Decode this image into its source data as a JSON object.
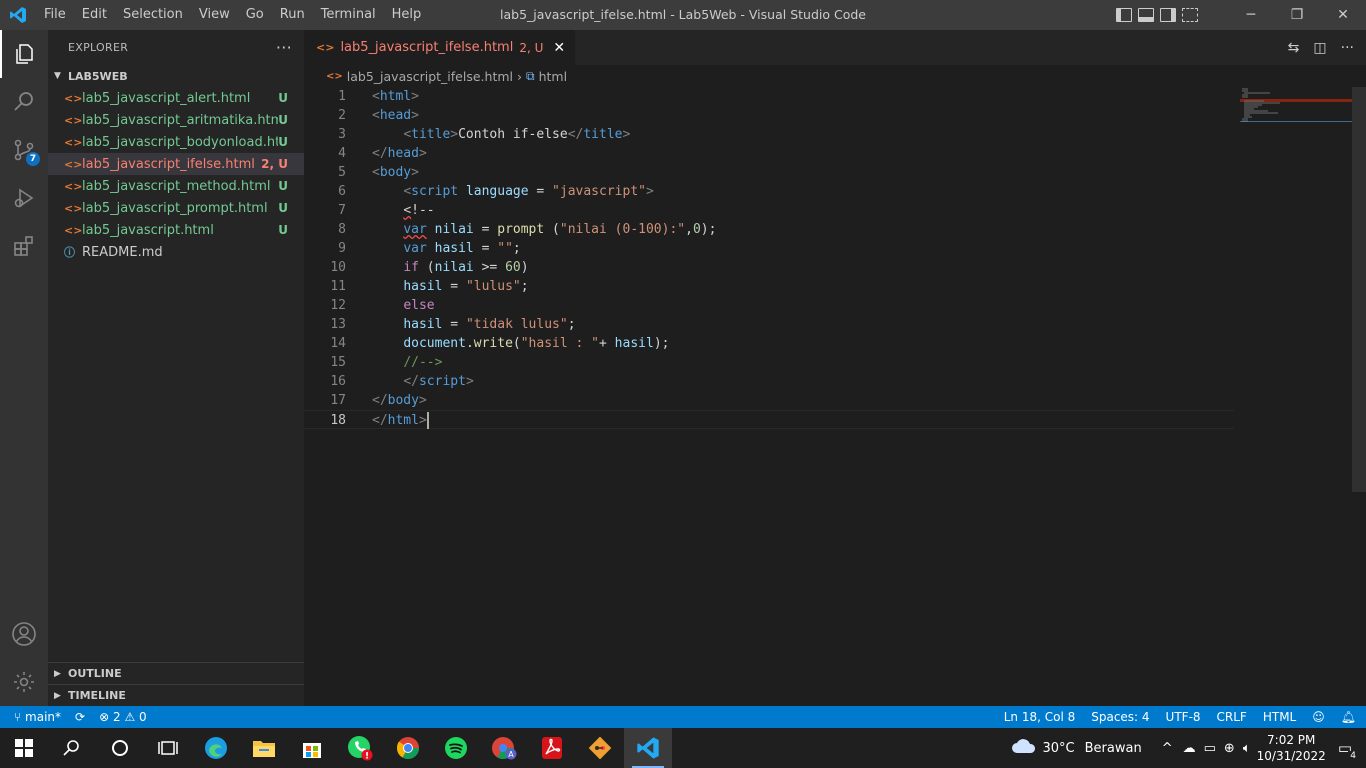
{
  "window": {
    "title": "lab5_javascript_ifelse.html - Lab5Web - Visual Studio Code",
    "menu": [
      "File",
      "Edit",
      "Selection",
      "View",
      "Go",
      "Run",
      "Terminal",
      "Help"
    ]
  },
  "activity": {
    "scm_badge": "7"
  },
  "explorer": {
    "header": "EXPLORER",
    "folder": "LAB5WEB",
    "files": [
      {
        "name": "lab5_javascript_alert.html",
        "status": "U"
      },
      {
        "name": "lab5_javascript_aritmatika.html",
        "status": "U"
      },
      {
        "name": "lab5_javascript_bodyonload.html",
        "status": "U"
      },
      {
        "name": "lab5_javascript_ifelse.html",
        "status": "2, U"
      },
      {
        "name": "lab5_javascript_method.html",
        "status": "U"
      },
      {
        "name": "lab5_javascript_prompt.html",
        "status": "U"
      },
      {
        "name": "lab5_javascript.html",
        "status": "U"
      },
      {
        "name": "README.md",
        "status": ""
      }
    ],
    "outline": "OUTLINE",
    "timeline": "TIMELINE"
  },
  "tab": {
    "name": "lab5_javascript_ifelse.html",
    "status": "2, U"
  },
  "breadcrumb": {
    "file": "lab5_javascript_ifelse.html",
    "symbol": "html"
  },
  "editor": {
    "line_numbers": [
      "1",
      "2",
      "3",
      "4",
      "5",
      "6",
      "7",
      "8",
      "9",
      "10",
      "11",
      "12",
      "13",
      "14",
      "15",
      "16",
      "17",
      "18"
    ],
    "code": {
      "title_text": "Contoh if-else",
      "script_lang": "\"javascript\"",
      "l8_var": "var",
      "l8_name": "nilai",
      "l8_fn": "prompt",
      "l8_str": "\"nilai (0-100):\"",
      "l8_num": "0",
      "l9_str": "\"\"",
      "l10_num": "60",
      "l11_str": "\"lulus\"",
      "l13_str": "\"tidak lulus\"",
      "l14_str": "\"hasil : \""
    }
  },
  "status": {
    "branch": "main*",
    "errors": "2",
    "warnings": "0",
    "position": "Ln 18, Col 8",
    "spaces": "Spaces: 4",
    "encoding": "UTF-8",
    "eol": "CRLF",
    "language": "HTML"
  },
  "taskbar": {
    "weather_temp": "30°C",
    "weather_text": "Berawan",
    "time": "7:02 PM",
    "date": "10/31/2022",
    "notif_count": "4"
  },
  "colors": {
    "statusbar": "#007acc",
    "accent_modified": "#f88070",
    "untracked": "#73c991"
  }
}
